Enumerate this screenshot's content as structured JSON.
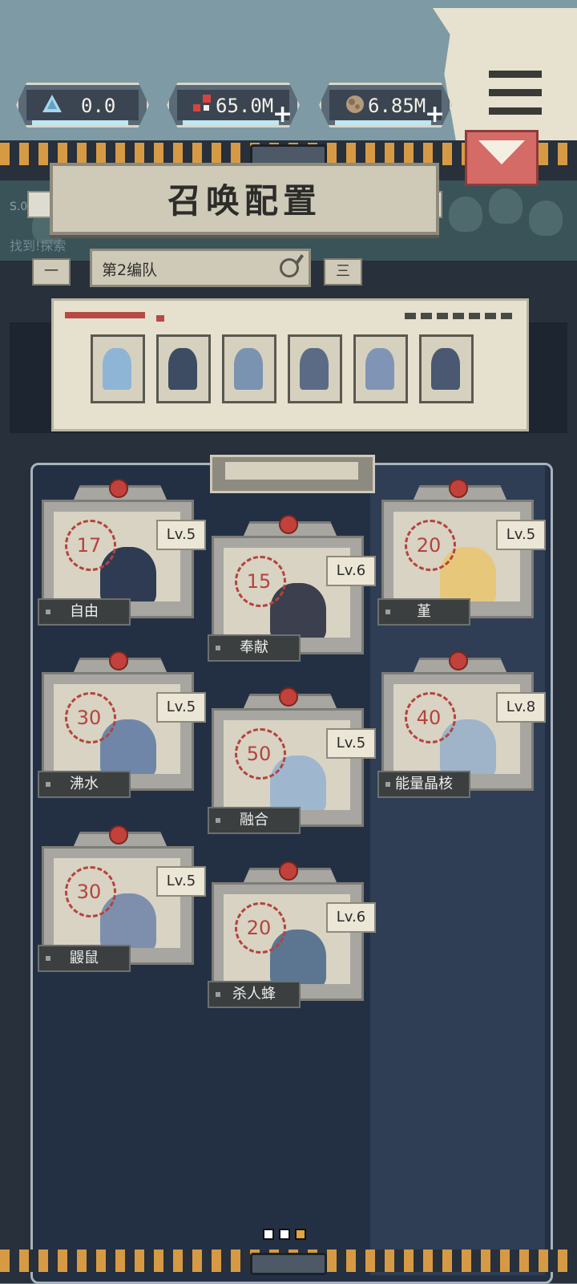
{
  "currencies": [
    {
      "name": "crystal",
      "icon": "triangle-crystal-icon",
      "value": "0.0",
      "has_plus": false
    },
    {
      "name": "gems",
      "icon": "red-gems-icon",
      "value": "65.0M",
      "has_plus": true
    },
    {
      "name": "ore",
      "icon": "ore-rock-icon",
      "value": "6.85M",
      "has_plus": true
    }
  ],
  "header": {
    "title": "召唤配置",
    "faint_line1": "S.0",
    "faint_line2": "找到!探索"
  },
  "team": {
    "name": "第2编队",
    "prev_label": "一",
    "next_label": "三"
  },
  "team_slots": [
    {
      "color": "#8fb5d6"
    },
    {
      "color": "#3d4b63"
    },
    {
      "color": "#7a93b0"
    },
    {
      "color": "#5b6b86"
    },
    {
      "color": "#8095b5"
    },
    {
      "color": "#4a5872"
    }
  ],
  "cards": [
    {
      "name": "自由",
      "cost": "17",
      "level": "Lv.5",
      "color": "#2f3b52"
    },
    {
      "name": "奉献",
      "cost": "15",
      "level": "Lv.6",
      "color": "#3c3f4d"
    },
    {
      "name": "堇",
      "cost": "20",
      "level": "Lv.5",
      "color": "#e7c77a"
    },
    {
      "name": "沸水",
      "cost": "30",
      "level": "Lv.5",
      "color": "#6f86a8"
    },
    {
      "name": "融合",
      "cost": "50",
      "level": "Lv.5",
      "color": "#9fb6cf"
    },
    {
      "name": "能量晶核",
      "cost": "40",
      "level": "Lv.8",
      "color": "#9fb3c9"
    },
    {
      "name": "鼹鼠",
      "cost": "30",
      "level": "Lv.5",
      "color": "#7e8fae"
    },
    {
      "name": "杀人蜂",
      "cost": "20",
      "level": "Lv.6",
      "color": "#5c7591"
    }
  ],
  "pager": {
    "count": 3,
    "active": 2
  },
  "colors": {
    "panel": "#27303b",
    "stripe": "#d69a45",
    "accent_red": "#d46b67",
    "cost_red": "#b5433d",
    "paper": "#e6e1cf"
  }
}
